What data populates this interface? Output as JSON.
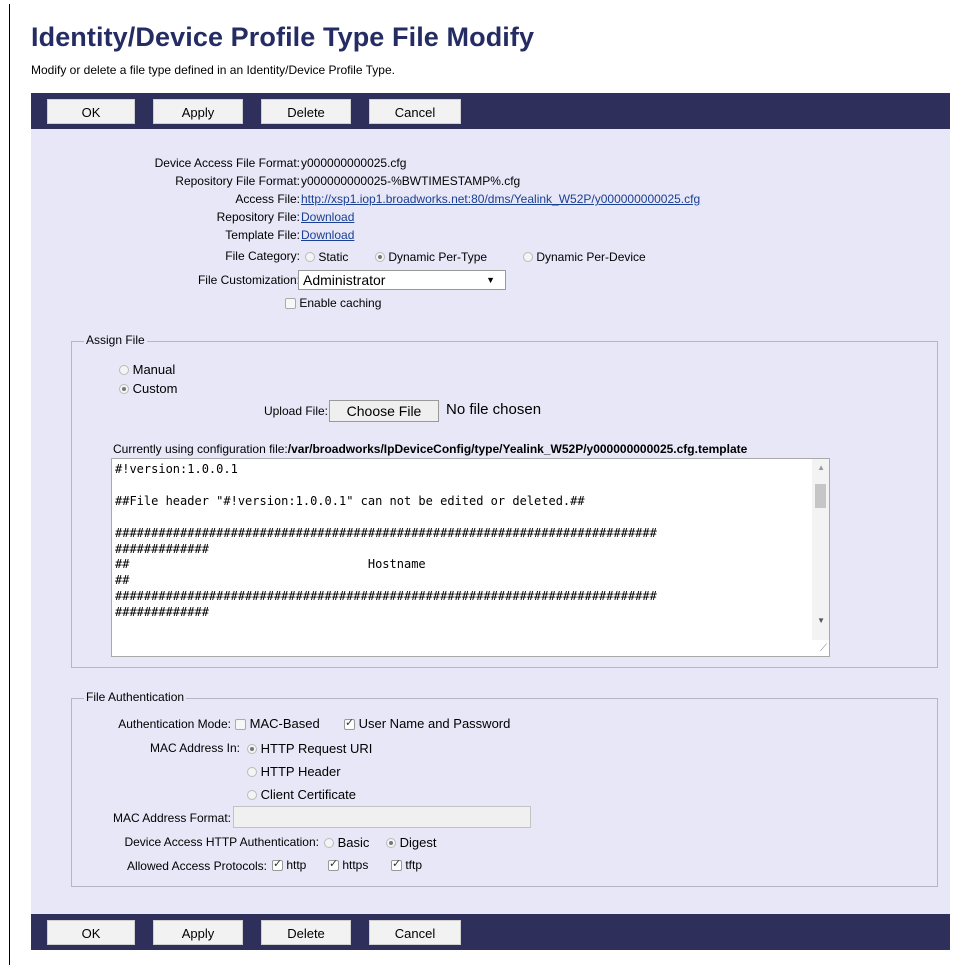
{
  "page": {
    "title": "Identity/Device Profile Type File Modify",
    "subtitle": "Modify or delete a file type defined in an Identity/Device Profile Type."
  },
  "buttons": {
    "ok": "OK",
    "apply": "Apply",
    "delete": "Delete",
    "cancel": "Cancel"
  },
  "details": {
    "device_access_label": "Device Access File Format:",
    "device_access_value": "y000000000025.cfg",
    "repository_format_label": "Repository File Format:",
    "repository_format_value": "y000000000025-%BWTIMESTAMP%.cfg",
    "access_file_label": "Access File:",
    "access_file_value": "http://xsp1.iop1.broadworks.net:80/dms/Yealink_W52P/y000000000025.cfg",
    "repository_file_label": "Repository File:",
    "repository_file_link": "Download",
    "template_file_label": "Template File:",
    "template_file_link": "Download",
    "file_category_label": "File Category:",
    "file_category_options": [
      "Static",
      "Dynamic Per-Type",
      "Dynamic Per-Device"
    ],
    "file_category_selected": "Dynamic Per-Type",
    "file_customization_label": "File Customization:",
    "file_customization_value": "Administrator",
    "enable_caching_label": "Enable caching",
    "enable_caching_checked": false
  },
  "assign_file": {
    "legend": "Assign File",
    "manual_label": "Manual",
    "custom_label": "Custom",
    "selected": "Custom",
    "upload_label": "Upload File:",
    "choose_file_button": "Choose File",
    "no_file_text": "No file chosen",
    "currently_using_prefix": "Currently using configuration file:",
    "currently_using_path": "/var/broadworks/IpDeviceConfig/type/Yealink_W52P/y000000000025.cfg.template",
    "file_content": "#!version:1.0.0.1\n\n##File header \"#!version:1.0.0.1\" can not be edited or deleted.##\n\n###########################################################################\n#############\n##                                 Hostname\n##\n###########################################################################\n#############"
  },
  "file_auth": {
    "legend": "File Authentication",
    "auth_mode_label": "Authentication Mode:",
    "mac_based_label": "MAC-Based",
    "mac_based_checked": false,
    "user_pass_label": "User Name and Password",
    "user_pass_checked": true,
    "mac_in_label": "MAC Address In:",
    "mac_in_options": [
      "HTTP Request URI",
      "HTTP Header",
      "Client Certificate"
    ],
    "mac_in_selected": "HTTP Request URI",
    "mac_format_label": "MAC Address Format:",
    "mac_format_value": "",
    "http_auth_label": "Device Access HTTP Authentication:",
    "http_auth_options": [
      "Basic",
      "Digest"
    ],
    "http_auth_selected": "Digest",
    "protocols_label": "Allowed Access Protocols:",
    "protocols": [
      "http",
      "https",
      "tftp"
    ]
  }
}
